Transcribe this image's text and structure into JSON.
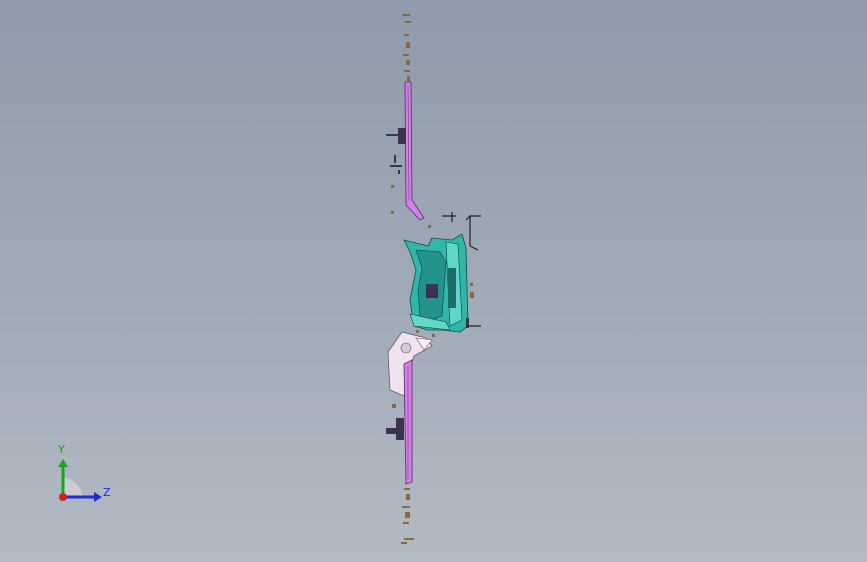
{
  "viewport": {
    "background_top": "#8f9bab",
    "background_bottom": "#b2bac4"
  },
  "triad": {
    "y_label": "Y",
    "z_label": "Z",
    "y_color": "#1aa51a",
    "z_color": "#1f2ad8",
    "x_color": "#d81f1f"
  },
  "model": {
    "upper_rail_color": "#d57de8",
    "lower_rail_color": "#d57de8",
    "center_part_color": "#2fb8a8",
    "dark_part_color": "#3c3350",
    "bracket_color": "#efe3ee",
    "screw_color": "#8a6a3a"
  }
}
